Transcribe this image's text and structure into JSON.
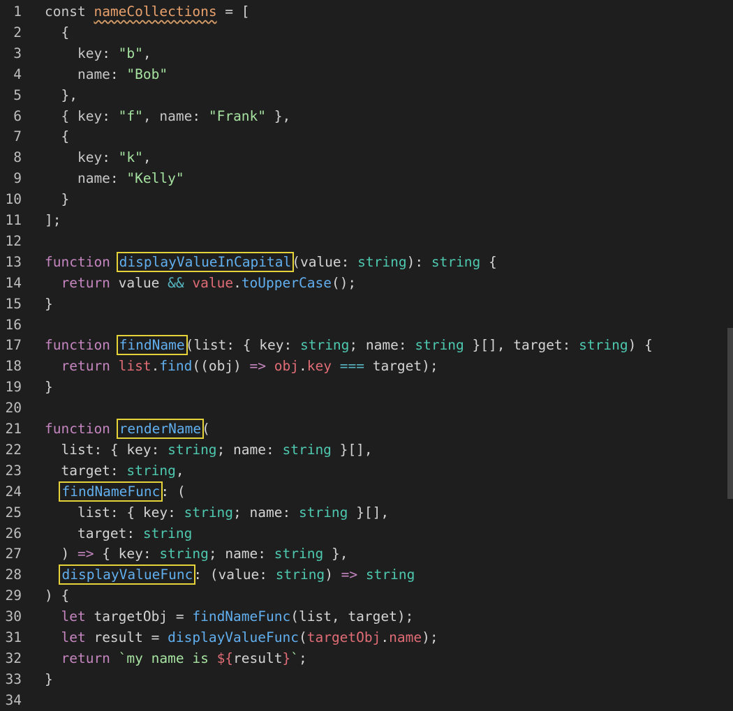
{
  "editor": {
    "language": "typescript",
    "theme_colors": {
      "background": "#1e1e1e",
      "keyword": "#c586c0",
      "function": "#61afef",
      "type": "#4ec9b0",
      "string": "#a6e3a1",
      "highlight_box": "#e6d33a"
    },
    "lines": [
      [
        {
          "t": "const ",
          "c": "dcl"
        },
        {
          "t": "nameCollections",
          "c": "var squig"
        },
        {
          "t": " = [",
          "c": "pl"
        }
      ],
      [
        {
          "t": "  {",
          "c": "pl"
        }
      ],
      [
        {
          "t": "    key",
          "c": "prop"
        },
        {
          "t": ": ",
          "c": "pl"
        },
        {
          "t": "\"b\"",
          "c": "str"
        },
        {
          "t": ",",
          "c": "pl"
        }
      ],
      [
        {
          "t": "    name",
          "c": "prop"
        },
        {
          "t": ": ",
          "c": "pl"
        },
        {
          "t": "\"Bob\"",
          "c": "str"
        }
      ],
      [
        {
          "t": "  },",
          "c": "pl"
        }
      ],
      [
        {
          "t": "  { key",
          "c": "prop"
        },
        {
          "t": ": ",
          "c": "pl"
        },
        {
          "t": "\"f\"",
          "c": "str"
        },
        {
          "t": ", name",
          "c": "prop"
        },
        {
          "t": ": ",
          "c": "pl"
        },
        {
          "t": "\"Frank\"",
          "c": "str"
        },
        {
          "t": " },",
          "c": "pl"
        }
      ],
      [
        {
          "t": "  {",
          "c": "pl"
        }
      ],
      [
        {
          "t": "    key",
          "c": "prop"
        },
        {
          "t": ": ",
          "c": "pl"
        },
        {
          "t": "\"k\"",
          "c": "str"
        },
        {
          "t": ",",
          "c": "pl"
        }
      ],
      [
        {
          "t": "    name",
          "c": "prop"
        },
        {
          "t": ": ",
          "c": "pl"
        },
        {
          "t": "\"Kelly\"",
          "c": "str"
        }
      ],
      [
        {
          "t": "  }",
          "c": "pl"
        }
      ],
      [
        {
          "t": "];",
          "c": "pl"
        }
      ],
      [],
      [
        {
          "t": "function ",
          "c": "kw"
        },
        {
          "t": "displayValueInCapital",
          "c": "fn hl"
        },
        {
          "t": "(value",
          "c": "pl"
        },
        {
          "t": ": ",
          "c": "pl"
        },
        {
          "t": "string",
          "c": "ty"
        },
        {
          "t": "): ",
          "c": "pl"
        },
        {
          "t": "string",
          "c": "ty"
        },
        {
          "t": " {",
          "c": "pl"
        }
      ],
      [
        {
          "t": "  return ",
          "c": "kw"
        },
        {
          "t": "value ",
          "c": "pl"
        },
        {
          "t": "&& ",
          "c": "op"
        },
        {
          "t": "value",
          "c": "red"
        },
        {
          "t": ".",
          "c": "pl"
        },
        {
          "t": "toUpperCase",
          "c": "fn"
        },
        {
          "t": "();",
          "c": "pl"
        }
      ],
      [
        {
          "t": "}",
          "c": "pl"
        }
      ],
      [],
      [
        {
          "t": "function ",
          "c": "kw"
        },
        {
          "t": "findName",
          "c": "fn hl"
        },
        {
          "t": "(list: { key",
          "c": "pl"
        },
        {
          "t": ": ",
          "c": "pl"
        },
        {
          "t": "string",
          "c": "ty"
        },
        {
          "t": "; name: ",
          "c": "pl"
        },
        {
          "t": "string",
          "c": "ty"
        },
        {
          "t": " }[], target: ",
          "c": "pl"
        },
        {
          "t": "string",
          "c": "ty"
        },
        {
          "t": ") {",
          "c": "pl"
        }
      ],
      [
        {
          "t": "  return ",
          "c": "kw"
        },
        {
          "t": "list",
          "c": "red"
        },
        {
          "t": ".",
          "c": "pl"
        },
        {
          "t": "find",
          "c": "fn"
        },
        {
          "t": "((obj) ",
          "c": "pl"
        },
        {
          "t": "=> ",
          "c": "kw"
        },
        {
          "t": "obj",
          "c": "red"
        },
        {
          "t": ".",
          "c": "pl"
        },
        {
          "t": "key ",
          "c": "red"
        },
        {
          "t": "=== ",
          "c": "op"
        },
        {
          "t": "target);",
          "c": "pl"
        }
      ],
      [
        {
          "t": "}",
          "c": "pl"
        }
      ],
      [],
      [
        {
          "t": "function ",
          "c": "kw"
        },
        {
          "t": "renderName",
          "c": "fn hl"
        },
        {
          "t": "(",
          "c": "pl"
        }
      ],
      [
        {
          "t": "  list: { key: ",
          "c": "pl"
        },
        {
          "t": "string",
          "c": "ty"
        },
        {
          "t": "; name: ",
          "c": "pl"
        },
        {
          "t": "string",
          "c": "ty"
        },
        {
          "t": " }[],",
          "c": "pl"
        }
      ],
      [
        {
          "t": "  target: ",
          "c": "pl"
        },
        {
          "t": "string",
          "c": "ty"
        },
        {
          "t": ",",
          "c": "pl"
        }
      ],
      [
        {
          "t": "  ",
          "c": "pl"
        },
        {
          "t": "findNameFunc",
          "c": "fn hl"
        },
        {
          "t": ": (",
          "c": "pl"
        }
      ],
      [
        {
          "t": "    list: { key: ",
          "c": "pl"
        },
        {
          "t": "string",
          "c": "ty"
        },
        {
          "t": "; name: ",
          "c": "pl"
        },
        {
          "t": "string",
          "c": "ty"
        },
        {
          "t": " }[],",
          "c": "pl"
        }
      ],
      [
        {
          "t": "    target: ",
          "c": "pl"
        },
        {
          "t": "string",
          "c": "ty"
        }
      ],
      [
        {
          "t": "  ) ",
          "c": "pl"
        },
        {
          "t": "=> ",
          "c": "kw"
        },
        {
          "t": "{ key: ",
          "c": "pl"
        },
        {
          "t": "string",
          "c": "ty"
        },
        {
          "t": "; name: ",
          "c": "pl"
        },
        {
          "t": "string",
          "c": "ty"
        },
        {
          "t": " },",
          "c": "pl"
        }
      ],
      [
        {
          "t": "  ",
          "c": "pl"
        },
        {
          "t": "displayValueFunc",
          "c": "fn hl"
        },
        {
          "t": ": (value: ",
          "c": "pl"
        },
        {
          "t": "string",
          "c": "ty"
        },
        {
          "t": ") ",
          "c": "pl"
        },
        {
          "t": "=> ",
          "c": "kw"
        },
        {
          "t": "string",
          "c": "ty"
        }
      ],
      [
        {
          "t": ") {",
          "c": "pl"
        }
      ],
      [
        {
          "t": "  let ",
          "c": "kw"
        },
        {
          "t": "targetObj = ",
          "c": "pl"
        },
        {
          "t": "findNameFunc",
          "c": "fn"
        },
        {
          "t": "(list, target);",
          "c": "pl"
        }
      ],
      [
        {
          "t": "  let ",
          "c": "kw"
        },
        {
          "t": "result = ",
          "c": "pl"
        },
        {
          "t": "displayValueFunc",
          "c": "fn"
        },
        {
          "t": "(",
          "c": "pl"
        },
        {
          "t": "targetObj",
          "c": "red"
        },
        {
          "t": ".",
          "c": "pl"
        },
        {
          "t": "name",
          "c": "red"
        },
        {
          "t": ");",
          "c": "pl"
        }
      ],
      [
        {
          "t": "  return ",
          "c": "kw"
        },
        {
          "t": "`my name is ",
          "c": "str"
        },
        {
          "t": "${",
          "c": "red"
        },
        {
          "t": "result",
          "c": "pl"
        },
        {
          "t": "}",
          "c": "red"
        },
        {
          "t": "`",
          "c": "str"
        },
        {
          "t": ";",
          "c": "pl"
        }
      ],
      [
        {
          "t": "}",
          "c": "pl"
        }
      ],
      []
    ]
  }
}
